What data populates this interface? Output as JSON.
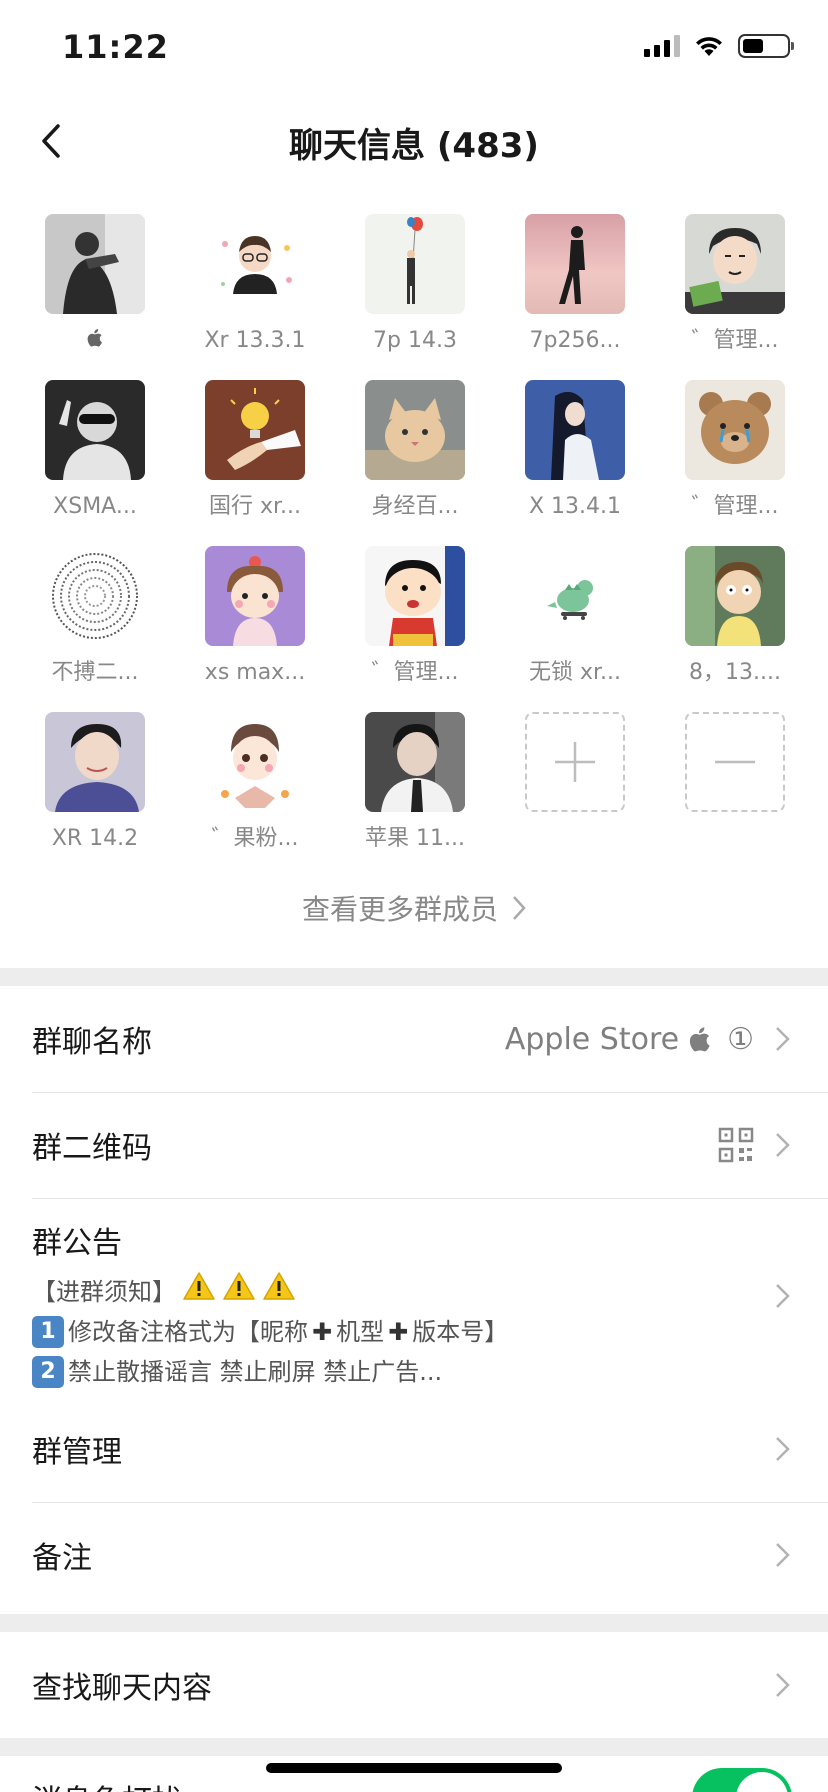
{
  "status_bar": {
    "time": "11:22"
  },
  "nav": {
    "title": "聊天信息 (483)"
  },
  "members": [
    {
      "name": "",
      "avatar": "photo-man-bw-icon"
    },
    {
      "name": "Xr 13.3.1",
      "avatar": "cartoon-boy-icon"
    },
    {
      "name": "7p  14.3",
      "avatar": "balloon-figure-icon"
    },
    {
      "name": "7p256...",
      "avatar": "walking-silhouette-icon"
    },
    {
      "name": "゛管理...",
      "avatar": "anime-boy-icon"
    },
    {
      "name": "XSMA...",
      "avatar": "sunglasses-man-icon"
    },
    {
      "name": "国行 xr...",
      "avatar": "lightbulb-icon"
    },
    {
      "name": "身经百...",
      "avatar": "cat-icon"
    },
    {
      "name": "X 13.4.1",
      "avatar": "anime-girl-icon"
    },
    {
      "name": "゛管理...",
      "avatar": "teddy-bear-icon"
    },
    {
      "name": "不搏二...",
      "avatar": "pi-spiral-icon"
    },
    {
      "name": "xs max...",
      "avatar": "cartoon-girl-icon"
    },
    {
      "name": "゛管理...",
      "avatar": "crayon-shin-icon"
    },
    {
      "name": "无锁 xr...",
      "avatar": "dinosaur-icon"
    },
    {
      "name": "8，13....",
      "avatar": "morty-icon"
    },
    {
      "name": "XR 14.2",
      "avatar": "young-man-icon"
    },
    {
      "name": "゛果粉...",
      "avatar": "chibi-boy-icon"
    },
    {
      "name": "苹果 11...",
      "avatar": "tie-man-icon"
    }
  ],
  "more_members_label": "查看更多群成员",
  "settings": {
    "group_name_label": "群聊名称",
    "group_name_value": "Apple Store",
    "group_name_suffix": "①",
    "qr_label": "群二维码",
    "notice_title": "群公告",
    "notice_line1": "【进群须知】",
    "notice_line2_a": "修改备注格式为【昵称",
    "notice_line2_b": "机型",
    "notice_line2_c": "版本号】",
    "notice_line3": "禁止散播谣言 禁止刷屏 禁止广告...",
    "badge_1": "1",
    "badge_2": "2",
    "manage_label": "群管理",
    "remark_label": "备注",
    "search_label": "查找聊天内容",
    "partial_label": "消息免打扰"
  },
  "colors": {
    "accent_green": "#07c160",
    "background": "#ededed"
  }
}
